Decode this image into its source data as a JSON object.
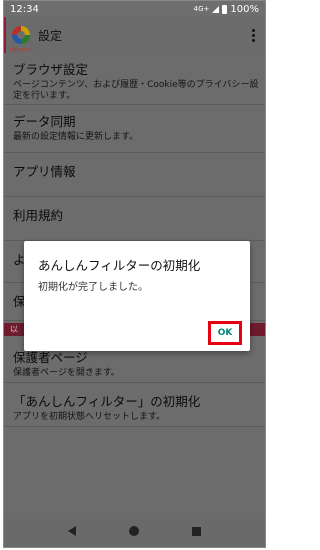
{
  "status_bar": {
    "time": "12:34",
    "network": "4G+",
    "battery": "100%"
  },
  "toolbar": {
    "title": "設定",
    "logo_text": "docomo"
  },
  "settings": {
    "items": [
      {
        "title": "ブラウザ設定",
        "desc": "ページコンテンツ、および履歴・Cookie等のプライバシー設定を行います。"
      },
      {
        "title": "データ同期",
        "desc": "最新の設定情報に更新します。"
      },
      {
        "title": "アプリ情報",
        "desc": ""
      },
      {
        "title": "利用規約",
        "desc": ""
      },
      {
        "title": "よ",
        "desc": ""
      },
      {
        "title": "保",
        "desc": ""
      }
    ],
    "section_header": "以",
    "items_after": [
      {
        "title": "保護者ページ",
        "desc": "保護者ページを開きます。"
      },
      {
        "title": "「あんしんフィルター」の初期化",
        "desc": "アプリを初期状態へリセットします。"
      }
    ]
  },
  "dialog": {
    "title": "あんしんフィルターの初期化",
    "message": "初期化が完了しました。",
    "ok_label": "OK"
  },
  "colors": {
    "highlight": "#e60012",
    "ok_text": "#008577",
    "section_header": "#6e1b2e"
  }
}
